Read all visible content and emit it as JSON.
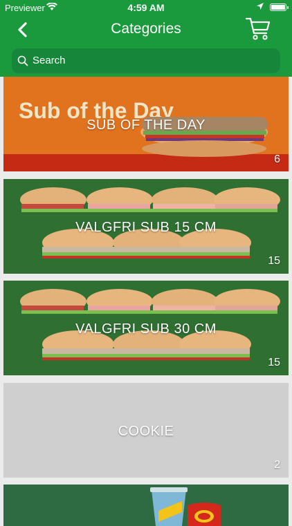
{
  "status_bar": {
    "carrier": "Previewer",
    "time": "4:59 AM"
  },
  "header": {
    "title": "Categories"
  },
  "search": {
    "placeholder": "Search"
  },
  "categories": [
    {
      "name": "SUB OF THE DAY",
      "count": "6",
      "image_text": "Sub of the Day"
    },
    {
      "name": "VALGFRI SUB 15 CM",
      "count": "15"
    },
    {
      "name": "VALGFRI SUB 30 CM",
      "count": "15"
    },
    {
      "name": "COOKIE",
      "count": "2"
    },
    {
      "name": "",
      "count": ""
    }
  ],
  "colors": {
    "brand_green": "#1a9a3c",
    "search_bg": "#16873a"
  }
}
